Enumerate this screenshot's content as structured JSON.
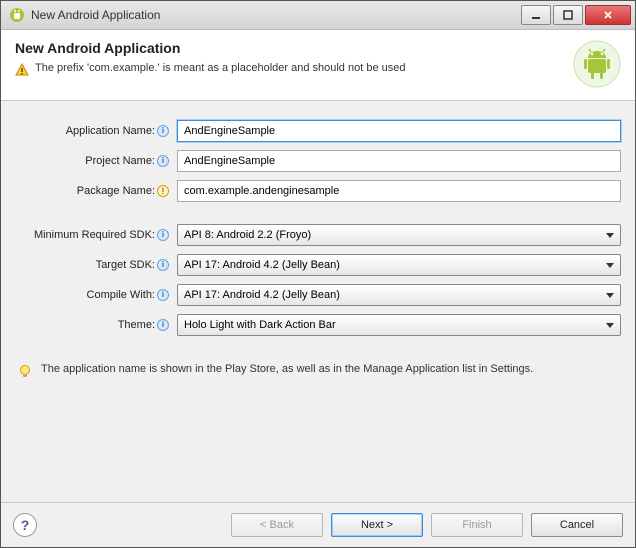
{
  "window": {
    "title": "New Android Application"
  },
  "header": {
    "title": "New Android Application",
    "warning": "The prefix 'com.example.' is meant as a placeholder and should not be used"
  },
  "fields": {
    "appName": {
      "label": "Application Name:",
      "value": "AndEngineSample"
    },
    "projectName": {
      "label": "Project Name:",
      "value": "AndEngineSample"
    },
    "packageName": {
      "label": "Package Name:",
      "value": "com.example.andenginesample"
    },
    "minSdk": {
      "label": "Minimum Required SDK:",
      "value": "API 8: Android 2.2 (Froyo)"
    },
    "targetSdk": {
      "label": "Target SDK:",
      "value": "API 17: Android 4.2 (Jelly Bean)"
    },
    "compileWith": {
      "label": "Compile With:",
      "value": "API 17: Android 4.2 (Jelly Bean)"
    },
    "theme": {
      "label": "Theme:",
      "value": "Holo Light with Dark Action Bar"
    }
  },
  "tip": "The application name is shown in the Play Store, as well as in the Manage Application list in Settings.",
  "buttons": {
    "back": "< Back",
    "next": "Next >",
    "finish": "Finish",
    "cancel": "Cancel"
  },
  "colors": {
    "accent": "#3a8de0",
    "android": "#a4c639"
  }
}
